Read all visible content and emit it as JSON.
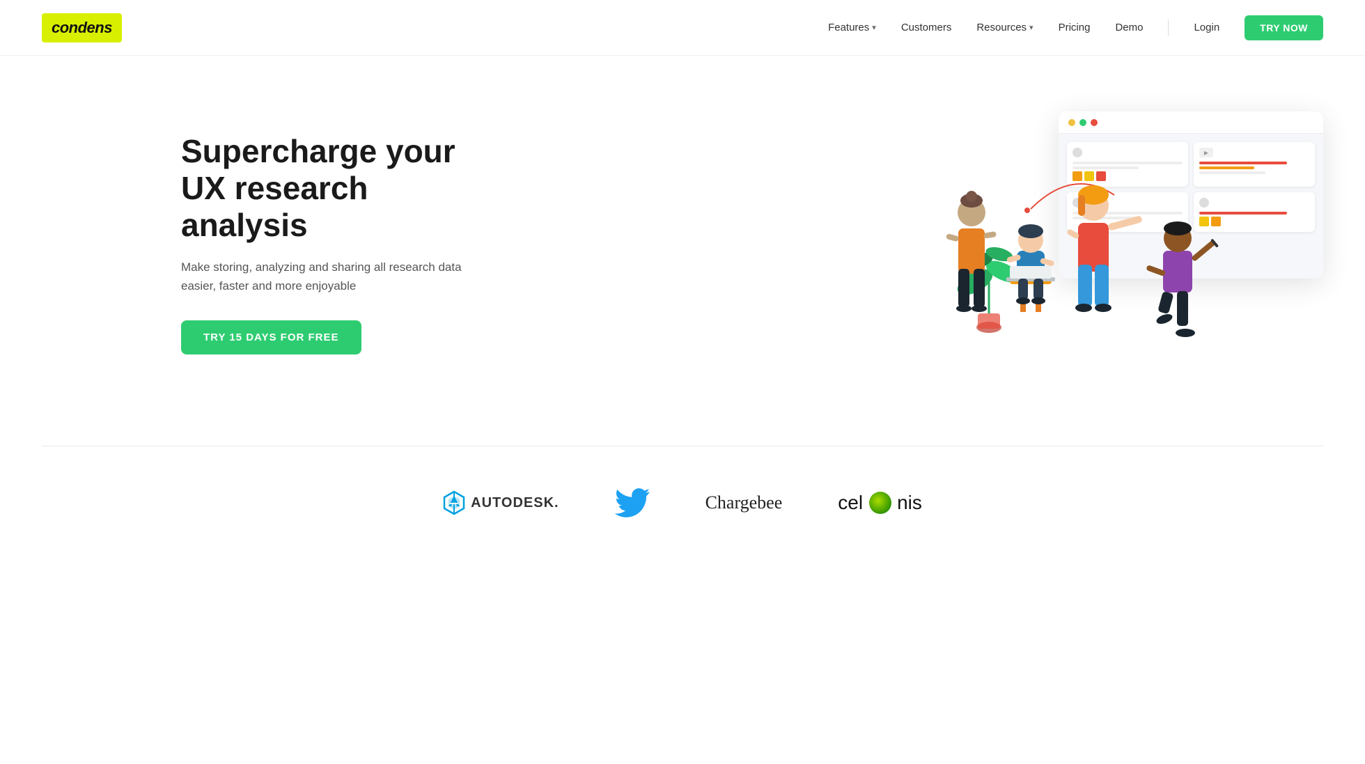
{
  "nav": {
    "logo": "condens",
    "links": [
      {
        "label": "Features",
        "has_dropdown": true
      },
      {
        "label": "Customers",
        "has_dropdown": false
      },
      {
        "label": "Resources",
        "has_dropdown": true
      },
      {
        "label": "Pricing",
        "has_dropdown": false
      },
      {
        "label": "Demo",
        "has_dropdown": false
      }
    ],
    "login_label": "Login",
    "try_now_label": "TRY NOW"
  },
  "hero": {
    "title_line1": "Supercharge your",
    "title_line2": "UX research analysis",
    "subtitle": "Make storing, analyzing and sharing all research data easier, faster and more enjoyable",
    "cta_label": "TRY 15 DAYS FOR FREE"
  },
  "logos": [
    {
      "name": "autodesk",
      "display": "AUTODESK."
    },
    {
      "name": "twitter",
      "display": ""
    },
    {
      "name": "chargebee",
      "display": "Chargebee"
    },
    {
      "name": "celonis",
      "display": "celonis"
    }
  ],
  "colors": {
    "brand_yellow": "#d8f000",
    "brand_green": "#2ecc71",
    "nav_bg": "#ffffff",
    "hero_bg": "#ffffff"
  }
}
